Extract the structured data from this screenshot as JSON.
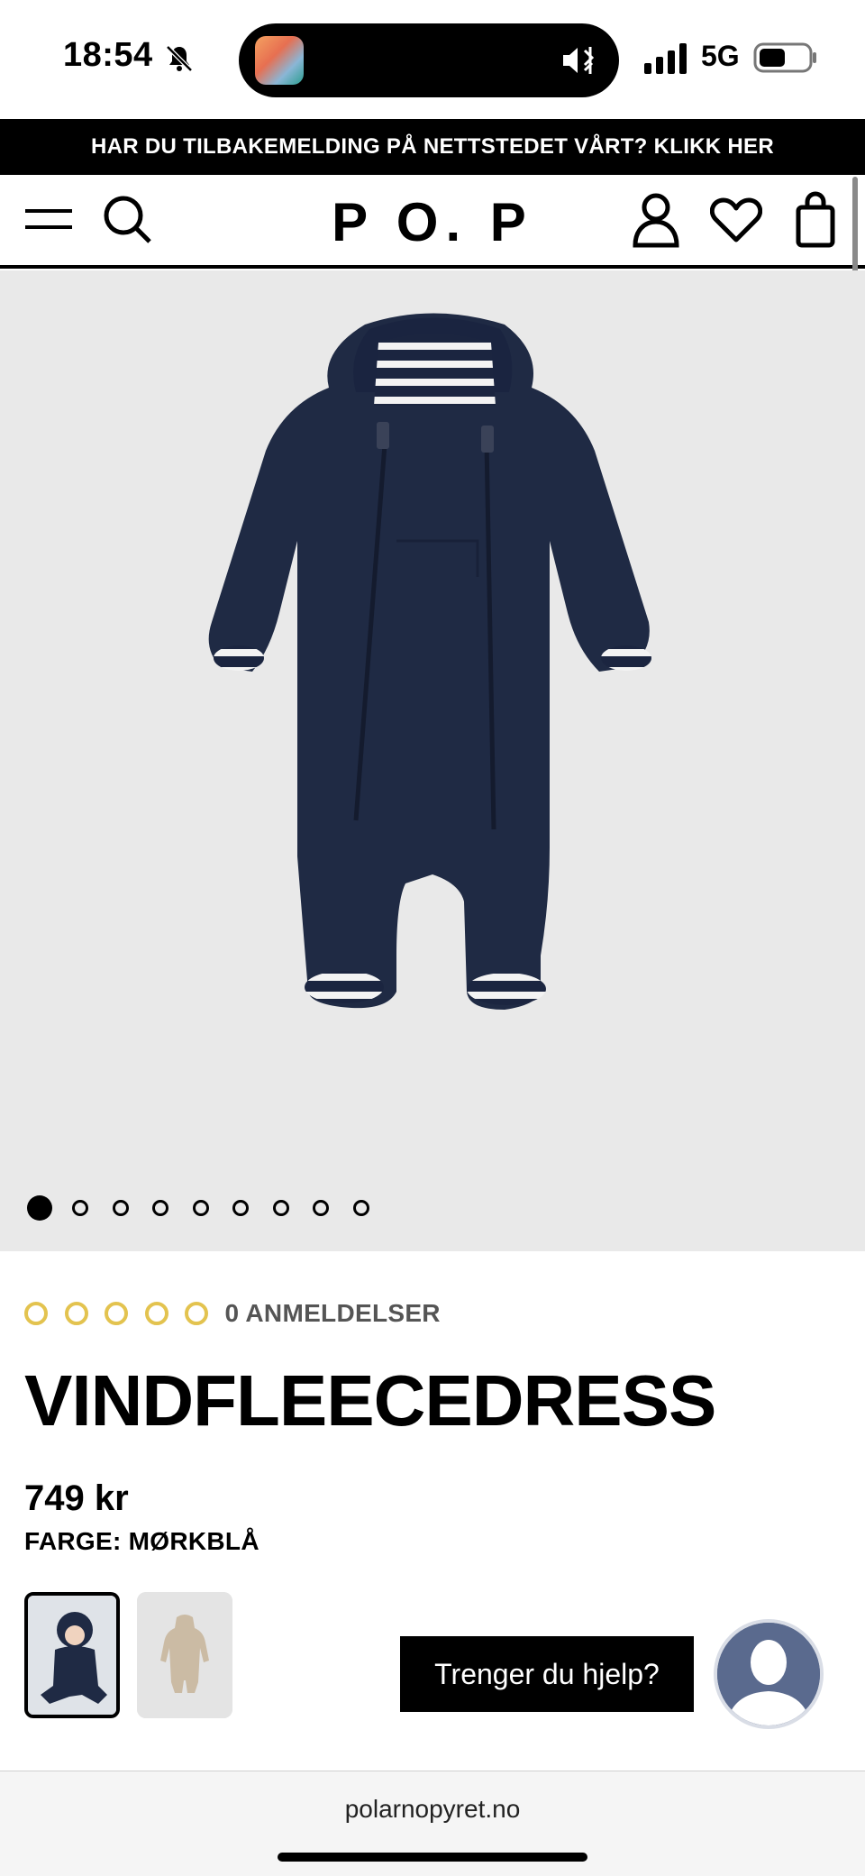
{
  "status_bar": {
    "time": "18:54",
    "network": "5G",
    "icons": [
      "bell-slash-icon",
      "app-thumbnail-icon",
      "silent-mode-icon",
      "signal-icon",
      "battery-icon"
    ]
  },
  "announcement": {
    "text": "HAR DU TILBAKEMELDING PÅ NETTSTEDET VÅRT? KLIKK HER"
  },
  "header": {
    "logo": "P O. P",
    "icons": [
      "menu-icon",
      "search-icon",
      "account-icon",
      "heart-icon",
      "bag-icon"
    ]
  },
  "gallery": {
    "image_count": 9,
    "active_index": 0
  },
  "product": {
    "rating_stars": 5,
    "rating_value": 0,
    "reviews_label": "0 ANMELDELSER",
    "title": "VINDFLEECEDRESS",
    "price": "749 kr",
    "color_label": "FARGE: MØRKBLÅ",
    "color_options": [
      "navy",
      "beige"
    ],
    "selected_color_index": 0
  },
  "help": {
    "button_label": "Trenger du hjelp?"
  },
  "browser": {
    "url": "polarnopyret.no"
  },
  "colors": {
    "accent_black": "#000000",
    "star_outline": "#e3c34f",
    "product_navy": "#1f2a44",
    "image_background": "#e9e9e9"
  }
}
